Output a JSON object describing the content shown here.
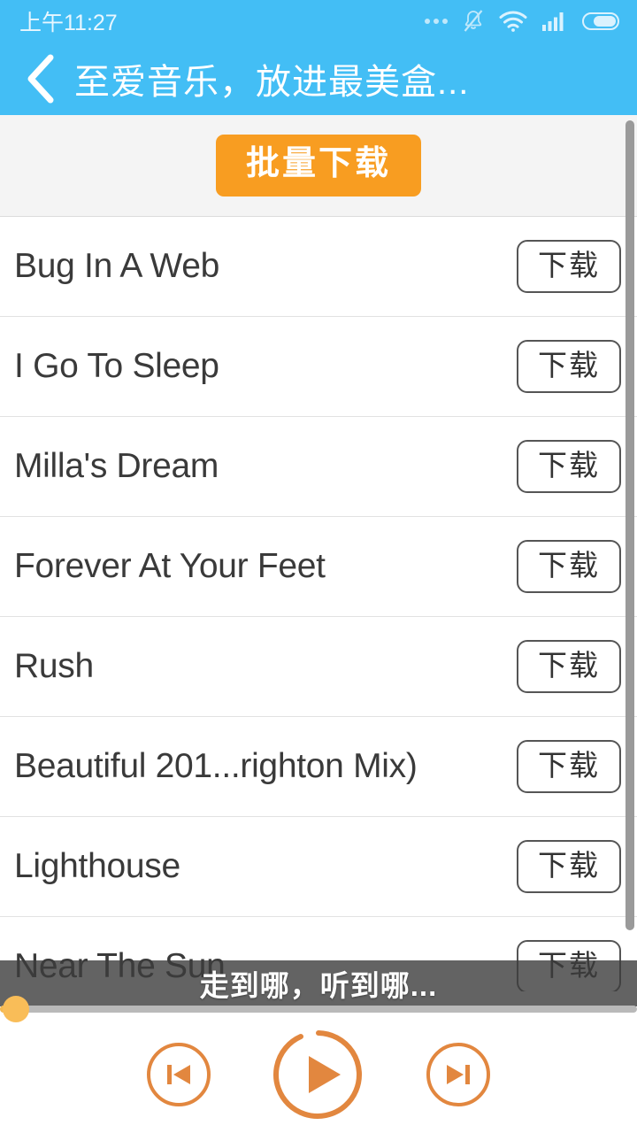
{
  "statusbar": {
    "time": "上午11:27",
    "icons": [
      {
        "name": "more-dots-icon"
      },
      {
        "name": "bell-muted-icon"
      },
      {
        "name": "wifi-icon"
      },
      {
        "name": "signal-icon"
      },
      {
        "name": "battery-icon"
      }
    ]
  },
  "header": {
    "back_icon": "chevron-left-icon",
    "title": "至爱音乐，放进最美盒..."
  },
  "batch": {
    "label": "批量下载"
  },
  "list": {
    "download_label": "下载",
    "songs": [
      {
        "title": "Bug In A Web"
      },
      {
        "title": "I Go To Sleep"
      },
      {
        "title": "Milla's Dream"
      },
      {
        "title": "Forever At Your Feet"
      },
      {
        "title": "Rush"
      },
      {
        "title": "Beautiful 201...righton Mix)"
      },
      {
        "title": "Lighthouse"
      },
      {
        "title": "Near The Sun"
      }
    ]
  },
  "overlay": {
    "text": "走到哪，听到哪..."
  },
  "progress": {
    "value_percent": 2
  },
  "player": {
    "prev_icon": "skip-previous-icon",
    "play_icon": "play-icon",
    "next_icon": "skip-next-icon"
  },
  "colors": {
    "header_blue": "#43bef5",
    "accent_orange": "#e8823c",
    "batch_orange": "#f89d21",
    "thumb_orange": "#f9bd58",
    "overlay_gray": "#3c3c3c",
    "band_gray": "#f4f4f4"
  }
}
